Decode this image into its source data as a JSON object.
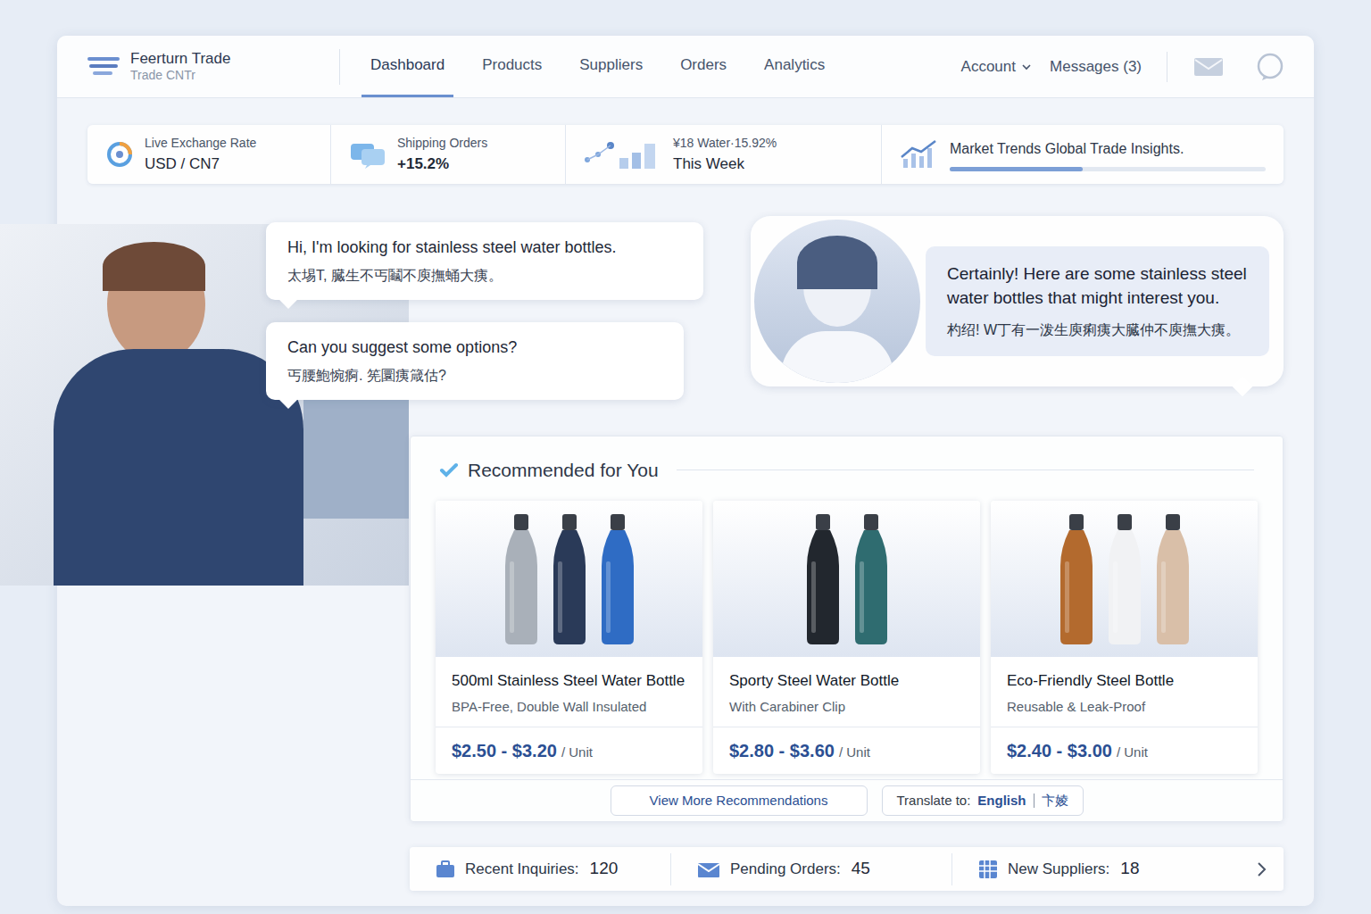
{
  "app": {
    "name": "Feerturn Trade",
    "subtitle": "Trade CNTr"
  },
  "nav": [
    {
      "label": "Dashboard",
      "selected": true
    },
    {
      "label": "Products",
      "selected": false
    },
    {
      "label": "Suppliers",
      "selected": false
    },
    {
      "label": "Orders",
      "selected": false
    },
    {
      "label": "Analytics",
      "selected": false
    }
  ],
  "account": {
    "label": "Account"
  },
  "messages": {
    "label": "Messages (3)"
  },
  "stats": [
    {
      "label": "Live Exchange Rate",
      "value": "USD / CN7"
    },
    {
      "label": "Shipping Orders",
      "value": "+15.2%"
    },
    {
      "label": "¥18 Water·15.92%",
      "value": "This Week"
    },
    {
      "label": "Market Trends Global Trade Insights.",
      "level": 0.42
    }
  ],
  "chat": {
    "user": [
      {
        "en": "Hi, I'm looking for stainless steel water bottles.",
        "zh": "太埸T, 臓生不丐鬮不庾撫蛹大痍。"
      },
      {
        "en": "Can you suggest some options?",
        "zh": "丐腰鮑惋痾. 筅圜痍箴估?"
      }
    ],
    "bot": {
      "en": "Certainly! Here are some stainless steel water bottles that might interest you.",
      "zh": "杓绍! W丁有一泼生庾痢痍大臓仲不庾撫大痍。"
    }
  },
  "recommend": {
    "title": "Recommended for You",
    "products": [
      {
        "name": "500ml Stainless Steel Water Bottle",
        "subtitle": "BPA-Free, Double Wall Insulated",
        "price": "$2.50 - $3.20",
        "unit": "/ Unit"
      },
      {
        "name": "Sporty Steel Water Bottle",
        "subtitle": "With Carabiner Clip",
        "price": "$2.80 - $3.60",
        "unit": "/ Unit"
      },
      {
        "name": "Eco-Friendly Steel Bottle",
        "subtitle": "Reusable & Leak-Proof",
        "price": "$2.40 - $3.00",
        "unit": "/ Unit"
      }
    ],
    "view_more": "View More Recommendations",
    "translate": {
      "label": "Translate to:",
      "options": [
        {
          "label": "English",
          "selected": true
        },
        {
          "label": "卞婈",
          "selected": false
        }
      ]
    }
  },
  "summary": [
    {
      "label": "Recent Inquiries:",
      "value": "120"
    },
    {
      "label": "Pending Orders:",
      "value": "45"
    },
    {
      "label": "New Suppliers:",
      "value": "18"
    }
  ]
}
